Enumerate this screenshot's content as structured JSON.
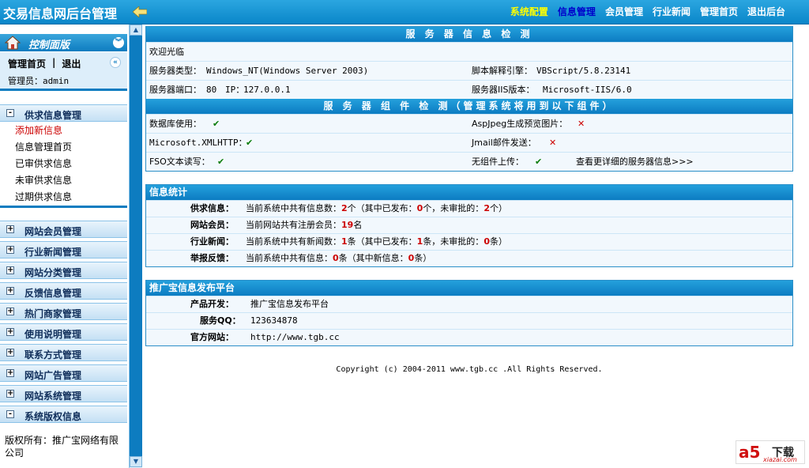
{
  "header": {
    "title": "交易信息网后台管理",
    "nav": [
      {
        "label": "系统配置",
        "state": "active"
      },
      {
        "label": "信息管理",
        "state": "current"
      },
      {
        "label": "会员管理",
        "state": "normal"
      },
      {
        "label": "行业新闻",
        "state": "normal"
      },
      {
        "label": "管理首页",
        "state": "normal"
      },
      {
        "label": "退出后台",
        "state": "normal"
      }
    ]
  },
  "sidebar": {
    "panel_title": "控制面版",
    "home_label": "管理首页",
    "separator": "|",
    "logout_label": "退出",
    "admin_line": "管理员：admin",
    "groups": {
      "supply": "供求信息管理",
      "member": "网站会员管理",
      "news": "行业新闻管理",
      "category": "网站分类管理",
      "feedback": "反馈信息管理",
      "merchant": "热门商家管理",
      "usage": "使用说明管理",
      "contact": "联系方式管理",
      "ads": "网站广告管理",
      "system": "网站系统管理",
      "copyright": "系统版权信息"
    },
    "supply_items": [
      "添加新信息",
      "信息管理首页",
      "已审供求信息",
      "未审供求信息",
      "过期供求信息"
    ],
    "copyright_text": "版权所有：推广宝网络有限公司"
  },
  "server": {
    "title": "服 务 器 信 息 检 测",
    "welcome": "欢迎光临",
    "type_label": "服务器类型：",
    "type_value": "Windows_NT(Windows Server 2003)",
    "script_label": "脚本解释引擎：",
    "script_value": "VBScript/5.8.23141",
    "port_label": "服务器端口：",
    "port_value": "80",
    "ip_label": "IP：",
    "ip_value": "127.0.0.1",
    "iis_label": "服务器IIS版本：",
    "iis_value": "Microsoft-IIS/6.0",
    "components_title": "服 务 器 组 件 检 测（管理系统将用到以下组件）",
    "db_label": "数据库使用：",
    "aspjpeg_label": "AspJpeg生成预览图片：",
    "xmlhttp_label": "Microsoft.XMLHTTP：",
    "jmail_label": "Jmail邮件发送：",
    "fso_label": "FSO文本读写：",
    "nocomp_label": "无组件上传：",
    "more_link": "查看更详细的服务器信息>>>",
    "check": "✔",
    "cross": "✕"
  },
  "stats": {
    "title": "信息统计",
    "supply_label": "供求信息：",
    "supply_pre": "当前系统中共有信息数：",
    "supply_total": "2",
    "supply_mid1": "个（其中已发布：",
    "supply_pub": "0",
    "supply_mid2": "个，未审批的：",
    "supply_pending": "2",
    "supply_end": "个）",
    "member_label": "网站会员：",
    "member_pre": "当前网站共有注册会员：",
    "member_count": "19",
    "member_end": "名",
    "news_label": "行业新闻：",
    "news_pre": "当前系统中共有新闻数：",
    "news_total": "1",
    "news_mid1": "条（其中已发布：",
    "news_pub": "1",
    "news_mid2": "条，未审批的：",
    "news_pending": "0",
    "news_end": "条）",
    "report_label": "举报反馈：",
    "report_pre": "当前系统中共有信息：",
    "report_total": "0",
    "report_mid": "条（其中新信息：",
    "report_new": "0",
    "report_end": "条）"
  },
  "platform": {
    "title": "推广宝信息发布平台",
    "dev_label": "产品开发：",
    "dev_value": "推广宝信息发布平台",
    "qq_label": "服务QQ：",
    "qq_value": "123634878",
    "site_label": "官方网站：",
    "site_value": "http://www.tgb.cc"
  },
  "footer": "Copyright (c) 2004-2011 www.tgb.cc .All Rights Reserved.",
  "watermark": {
    "brand": "a5",
    "text": "下载",
    "site": "xiazai.com"
  }
}
